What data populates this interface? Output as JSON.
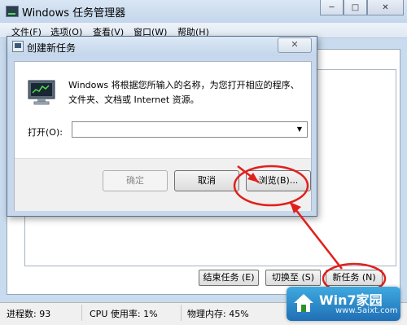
{
  "task_manager": {
    "title": "Windows 任务管理器",
    "window_controls": {
      "minimize": "─",
      "maximize": "□",
      "close": "✕"
    },
    "menu": [
      "文件(F)",
      "选项(O)",
      "查看(V)",
      "窗口(W)",
      "帮助(H)"
    ],
    "buttons": {
      "end_task": "结束任务 (E)",
      "switch_to": "切换至 (S)",
      "new_task": "新任务 (N)"
    },
    "status": {
      "processes": "进程数: 93",
      "cpu": "CPU 使用率: 1%",
      "memory": "物理内存: 45%"
    }
  },
  "run_dialog": {
    "title": "创建新任务",
    "description": "Windows 将根据您所输入的名称，为您打开相应的程序、文件夹、文档或 Internet 资源。",
    "open_label": "打开(O):",
    "open_value": "",
    "ok": "确定",
    "cancel": "取消",
    "browse": "浏览(B)..."
  },
  "watermark": {
    "title": "Win7家园",
    "url": "www.5aixt.com"
  },
  "colors": {
    "annotation": "#e0201c",
    "watermark_bg": "#1f6fb4"
  }
}
